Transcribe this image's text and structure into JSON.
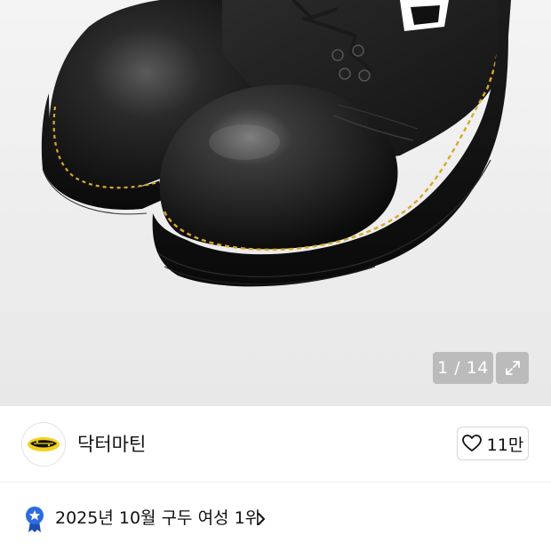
{
  "gallery": {
    "image_alt": "Dr. Martens black leather platform lace-up shoes",
    "current_index": 1,
    "total": 14,
    "counter_text": "1 / 14",
    "expand_icon": "expand-icon"
  },
  "brand": {
    "name": "닥터마틴",
    "logo_icon": "dr-martens-logo",
    "like_icon": "heart-outline-icon",
    "like_count": "11만"
  },
  "ranking": {
    "badge_icon": "ribbon-star-icon",
    "text": "2025년 10월 구두 여성 1위",
    "chevron_icon": "chevron-right-icon"
  },
  "colors": {
    "badge_blue": "#2c6be0",
    "stitch_yellow": "#d9a82a"
  }
}
